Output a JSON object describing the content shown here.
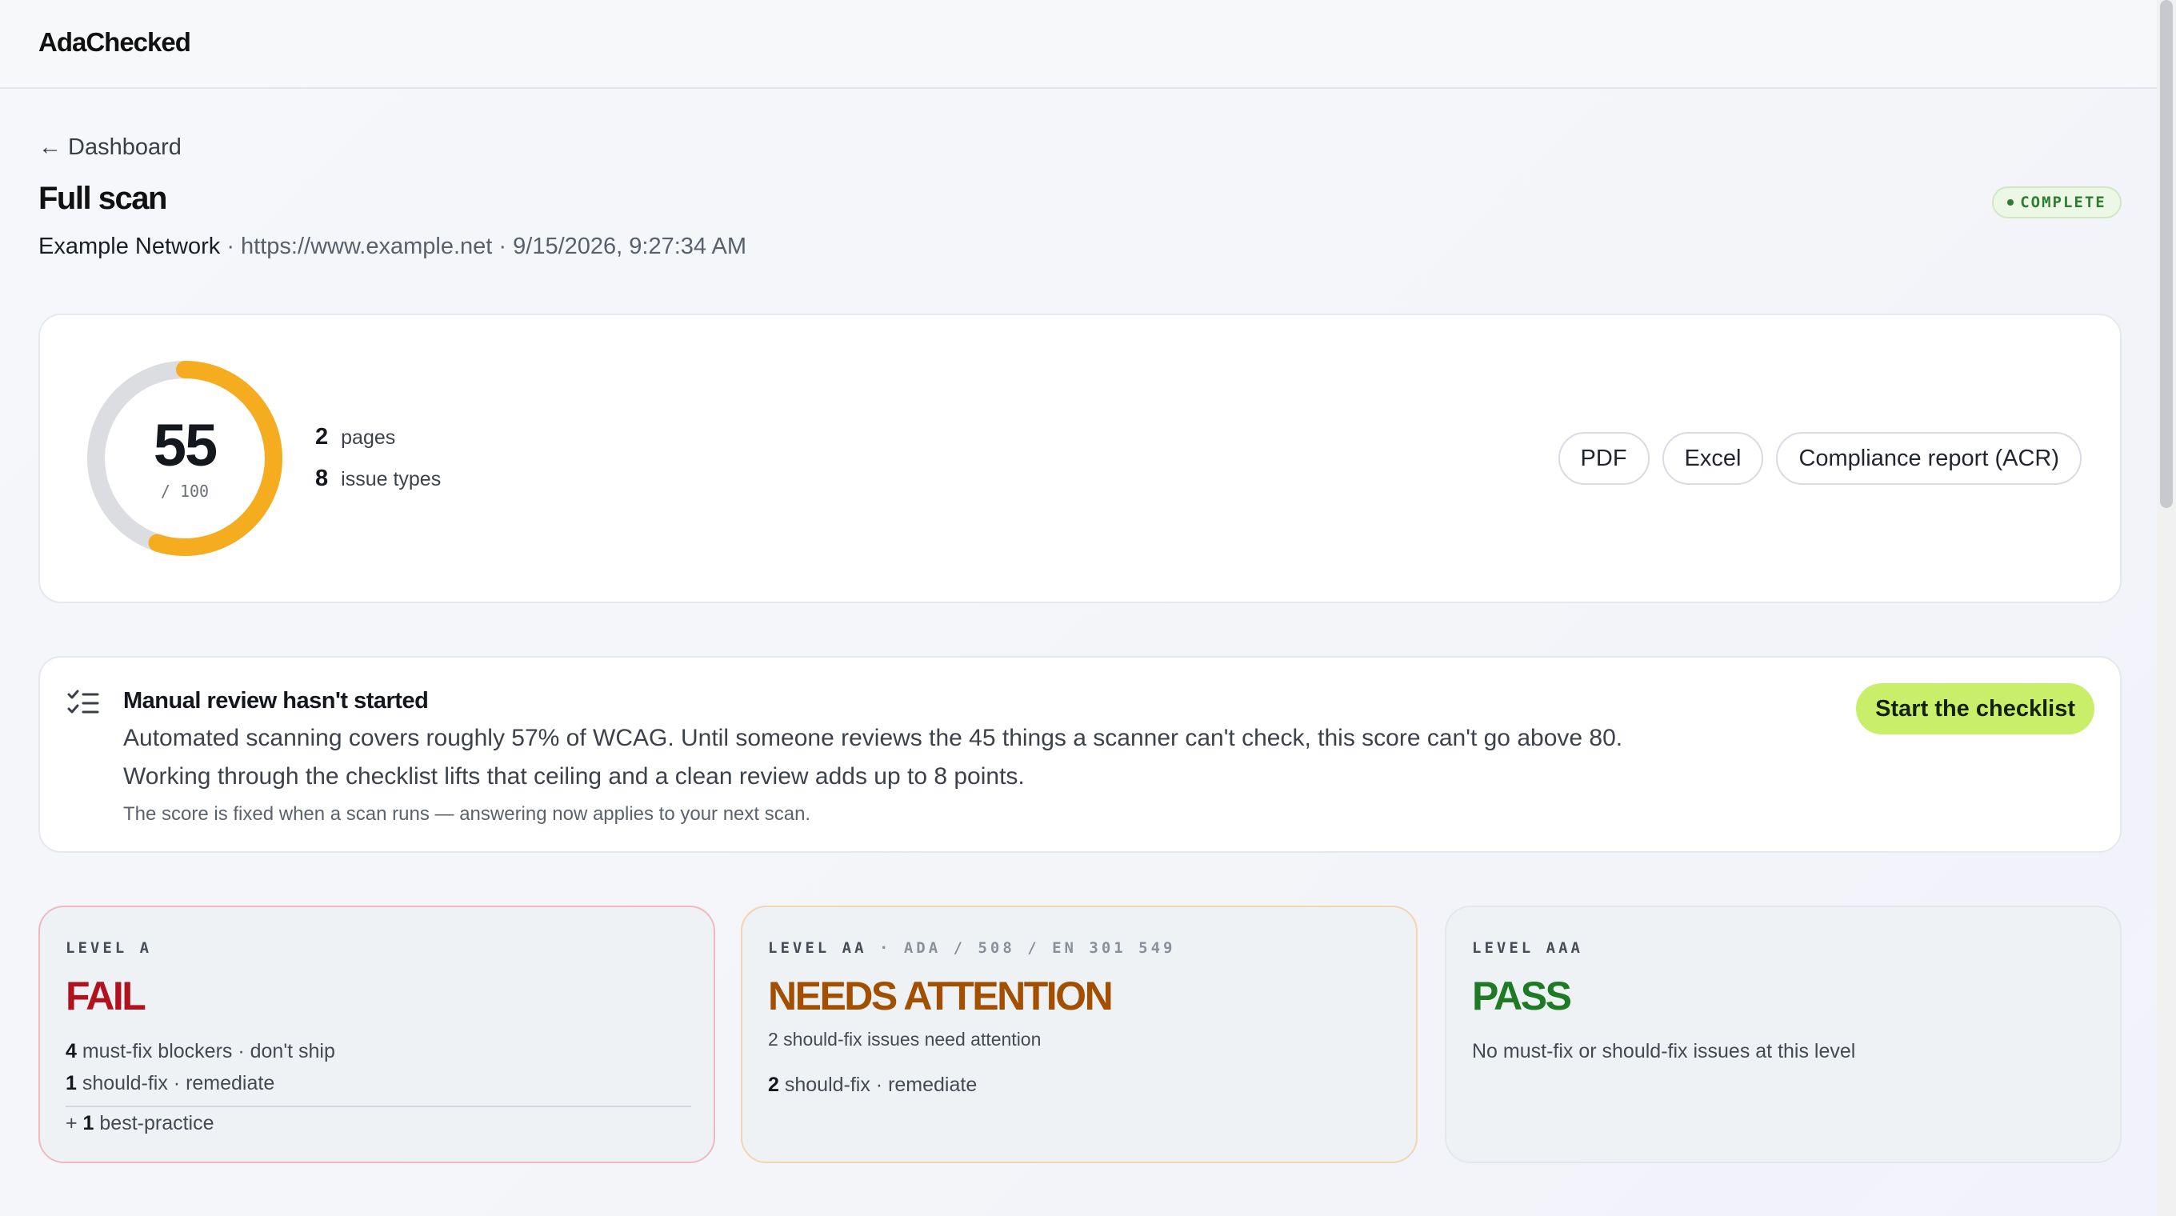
{
  "app": {
    "brand": "AdaChecked"
  },
  "nav": {
    "back_label": "Dashboard"
  },
  "scan": {
    "title": "Full scan",
    "site": "Example Network",
    "url": "https://www.example.net",
    "timestamp": "9/15/2026, 9:27:34 AM",
    "status": "COMPLETE",
    "status_color": "#2e7d32"
  },
  "score": {
    "value": "55",
    "max_label": "/ 100",
    "fraction": 0.55,
    "color": "#f5ad1f",
    "track_color": "#dcdde0",
    "pages_count": "2",
    "pages_label": "pages",
    "issue_types_count": "8",
    "issue_types_label": "issue types"
  },
  "exports": {
    "pdf": "PDF",
    "excel": "Excel",
    "acr": "Compliance report (ACR)"
  },
  "review": {
    "title": "Manual review hasn't started",
    "line1": "Automated scanning covers roughly 57% of WCAG. Until someone reviews the 45 things a scanner can't check, this score can't go above 80.",
    "line2": "Working through the checklist lifts that ceiling and a clean review adds up to 8 points.",
    "note": "The score is fixed when a scan runs — answering now applies to your next scan.",
    "cta": "Start the checklist",
    "cta_color": "#c9ef6a"
  },
  "levels": {
    "a": {
      "label": "LEVEL A",
      "verdict": "FAIL",
      "color": "#b0131f",
      "blockers_count": "4",
      "blockers_text": " must-fix blockers · don't ship",
      "should_count": "1",
      "should_text": " should-fix · remediate",
      "bp_prefix": "+ ",
      "bp_count": "1",
      "bp_text": " best-practice"
    },
    "aa": {
      "label": "LEVEL AA",
      "sublabel": " · ADA / 508 / EN 301 549",
      "verdict": "NEEDS ATTENTION",
      "color": "#a24f00",
      "summary": "2 should-fix issues need attention",
      "should_count": "2",
      "should_text": " should-fix · remediate"
    },
    "aaa": {
      "label": "LEVEL AAA",
      "verdict": "PASS",
      "color": "#1e7a24",
      "summary": "No must-fix or should-fix issues at this level"
    }
  }
}
